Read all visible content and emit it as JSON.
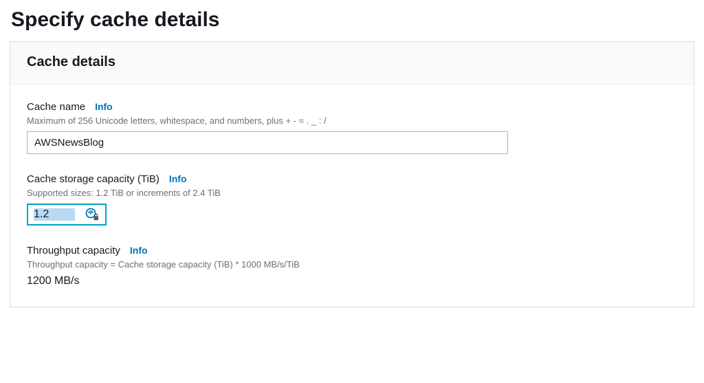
{
  "page": {
    "title": "Specify cache details"
  },
  "panel": {
    "header": "Cache details"
  },
  "cacheName": {
    "label": "Cache name",
    "info": "Info",
    "hint": "Maximum of 256 Unicode letters, whitespace, and numbers, plus + - = . _ : /",
    "value": "AWSNewsBlog"
  },
  "storageCapacity": {
    "label": "Cache storage capacity (TiB)",
    "info": "Info",
    "hint": "Supported sizes: 1.2 TiB or increments of 2.4 TiB",
    "value": "1.2"
  },
  "throughput": {
    "label": "Throughput capacity",
    "info": "Info",
    "hint": "Throughput capacity = Cache storage capacity (TiB) * 1000 MB/s/TiB",
    "value": "1200 MB/s"
  }
}
